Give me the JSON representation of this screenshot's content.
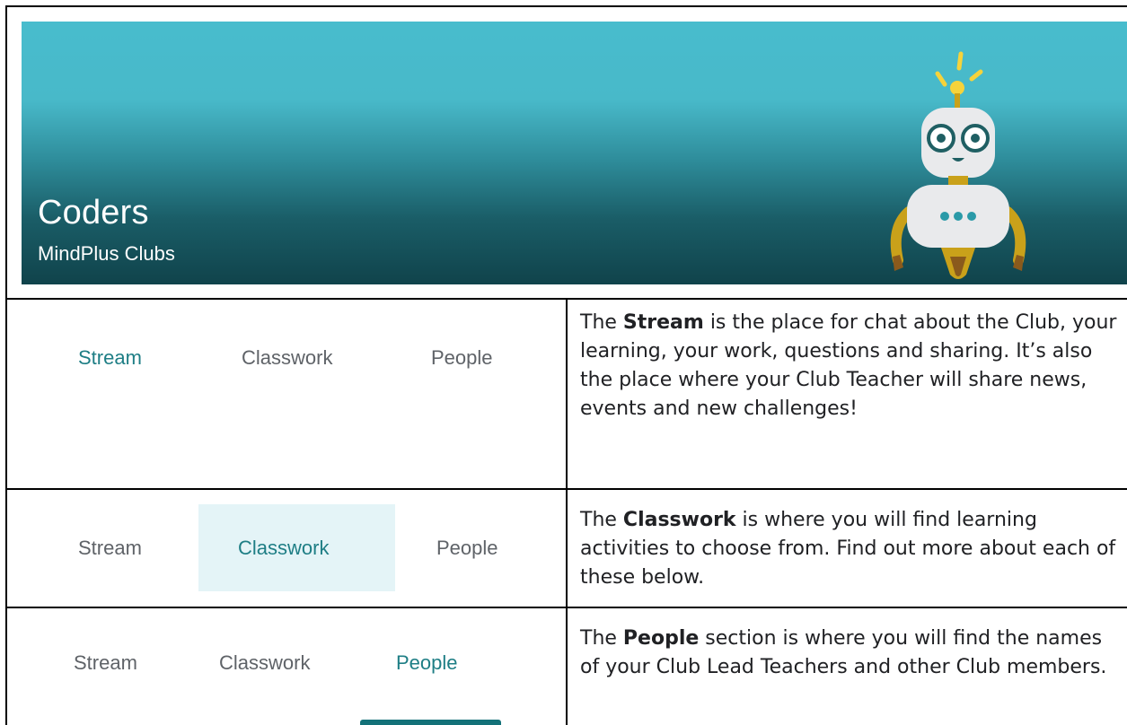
{
  "banner": {
    "title": "Coders",
    "subtitle": "MindPlus Clubs"
  },
  "rows": [
    {
      "tabs": [
        "Stream",
        "Classwork",
        "People"
      ],
      "active": "Stream",
      "desc_lead": "The ",
      "desc_bold": "Stream",
      "desc_rest": " is the place for chat about the Club, your learning, your work, questions and sharing. It’s also the place where your Club Teacher will share news, events and new challenges!"
    },
    {
      "tabs": [
        "Stream",
        "Classwork",
        "People"
      ],
      "active": "Classwork",
      "desc_lead": "The ",
      "desc_bold": "Classwork",
      "desc_rest": " is where you will find learning activities to choose from. Find out more about each of these below."
    },
    {
      "tabs": [
        "Stream",
        "Classwork",
        "People"
      ],
      "active": "People",
      "desc_lead": "The ",
      "desc_bold": "People",
      "desc_rest": " section is where you will find the names of your Club Lead Teachers and other Club members."
    }
  ],
  "colors": {
    "active_tab": "#1e7e85",
    "inactive_tab": "#5f6368",
    "highlight_bg": "#e4f4f7",
    "underline": "#137178"
  }
}
